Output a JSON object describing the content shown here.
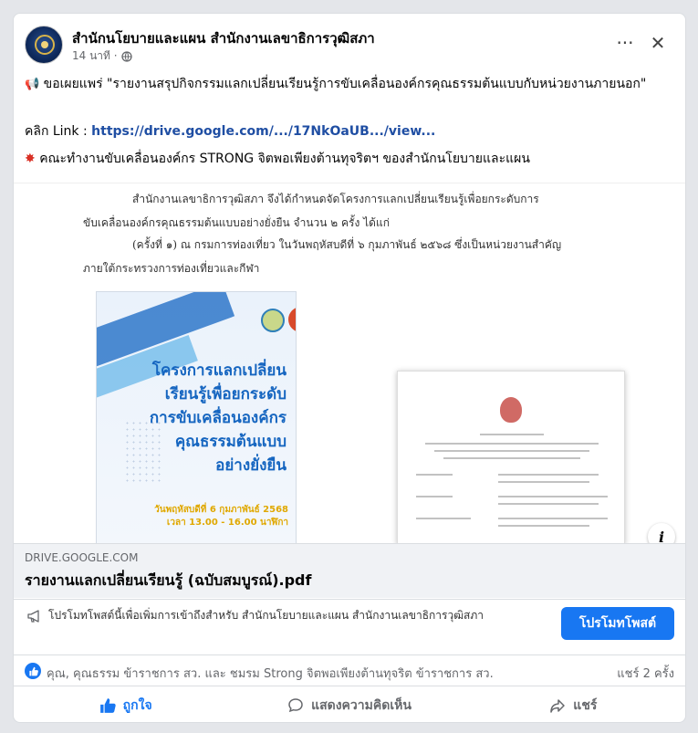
{
  "post": {
    "page_name": "สำนักนโยบายและแผน สำนักงานเลขาธิการวุฒิสภา",
    "time": "14 นาที ·",
    "text_line1": "ขอเผยแพร่ \"รายงานสรุปกิจกรรมแลกเปลี่ยนเรียนรู้การขับเคลื่อนองค์กรคุณธรรมต้นแบบกับหน่วยงานภายนอก\"",
    "link_label": "คลิก Link :",
    "link_url": "https://drive.google.com/.../17NkOaUB.../view...",
    "text_line3": "คณะทำงานขับเคลื่อนองค์กร STRONG จิตพอเพียงต้านทุจริตฯ ของสำนักนโยบายและแผน"
  },
  "preview": {
    "doc_lines": [
      "สำนักงานเลขาธิการวุฒิสภา จึงได้กำหนดจัดโครงการแลกเปลี่ยนเรียนรู้เพื่อยกระดับการ",
      "ขับเคลื่อนองค์กรคุณธรรมต้นแบบอย่างยั่งยืน จำนวน ๒ ครั้ง ได้แก่",
      "(ครั้งที่ ๑) ณ กรมการท่องเที่ยว ในวันพฤหัสบดีที่ ๖ กุมภาพันธ์ ๒๕๖๘ ซึ่งเป็นหน่วยงานสำคัญ",
      "ภายใต้กระทรวงการท่องเที่ยวและกีฬา"
    ],
    "poster_title": [
      "โครงการแลกเปลี่ยน",
      "เรียนรู้เพื่อยกระดับ",
      "การขับเคลื่อนองค์กร",
      "คุณธรรมต้นแบบ",
      "อย่างยั่งยืน"
    ],
    "poster_date": "วันพฤหัสบดีที่ 6 กุมภาพันธ์ 2568",
    "poster_time": "เวลา 13.00 - 16.00 นาฬิกา"
  },
  "link_card": {
    "domain": "DRIVE.GOOGLE.COM",
    "title": "รายงานแลกเปลี่ยนเรียนรู้ (ฉบับสมบูรณ์).pdf"
  },
  "promo": {
    "text": "โปรโมทโพสต์นี้เพื่อเพิ่มการเข้าถึงสำหรับ สำนักนโยบายและแผน สำนักงานเลขาธิการวุฒิสภา",
    "button": "โปรโมทโพสต์"
  },
  "reactions": {
    "names": "คุณ, คุณธรรม ข้าราชการ สว. และ ชมรม Strong จิตพอเพียงต้านทุจริต ข้าราชการ สว.",
    "shares": "แชร์ 2 ครั้ง"
  },
  "actions": {
    "like": "ถูกใจ",
    "comment": "แสดงความคิดเห็น",
    "share": "แชร์"
  },
  "colors": {
    "accent": "#1877f2",
    "link": "#1f4ea3",
    "muted": "#65676b"
  }
}
